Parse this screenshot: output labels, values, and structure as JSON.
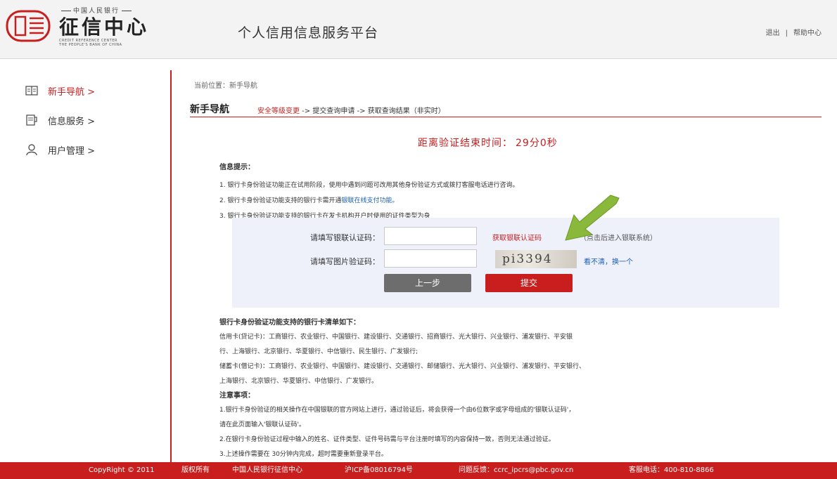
{
  "header": {
    "logo_top": "中国人民银行",
    "logo_main": "征信中心",
    "logo_en_1": "CREDIT REFERENCE CENTER",
    "logo_en_2": "THE PEOPLE'S BANK OF CHINA",
    "platform_title": "个人信用信息服务平台",
    "logout": "退出",
    "separator": "|",
    "help": "帮助中心"
  },
  "sidebar": {
    "items": [
      {
        "label": "新手导航 >",
        "icon": "book-icon",
        "active": true
      },
      {
        "label": "信息服务 >",
        "icon": "document-icon",
        "active": false
      },
      {
        "label": "用户管理 >",
        "icon": "user-icon",
        "active": false
      }
    ]
  },
  "main": {
    "breadcrumb": "当前位置：新手导航",
    "nav_title": "新手导航",
    "step_current": "安全等级变更",
    "step_rest": " -> 提交查询申请 -> 获取查询结果（非实时）",
    "countdown_label": "距离验证结束时间：",
    "countdown_value": "29分0秒",
    "tips_head": "信息提示：",
    "tip1": "1. 银行卡身份验证功能正在试用阶段，使用中遇到问题可改用其他身份验证方式或拨打客服电话进行咨询。",
    "tip2_pre": "2. 银行卡身份验证功能支持的银行卡需开通",
    "tip2_link": "银联在线支付功能。",
    "tip3": "3. 银行卡身份验证功能支持的银行卡在发卡机构开户时使用的证件类型为身",
    "form": {
      "unionpay_label": "请填写银联认证码：",
      "unionpay_value": "",
      "get_code_link": "获取银联认证码",
      "get_code_hint": "（点击后进入银联系统）",
      "captcha_label": "请填写图片验证码：",
      "captcha_value": "",
      "captcha_text": "pi3394",
      "refresh_link": "看不清，换一个",
      "prev_button": "上一步",
      "submit_button": "提交"
    },
    "support_head": "银行卡身份验证功能支持的银行卡清单如下：",
    "credit_line1": "信用卡(贷记卡)：工商银行、农业银行、中国银行、建设银行、交通银行、招商银行、光大银行、兴业银行、浦发银行、平安银",
    "credit_line2": "行、上海银行、北京银行、华夏银行、中信银行、民生银行、广发银行;",
    "debit_line1": "储蓄卡(借记卡)：工商银行、农业银行、中国银行、建设银行、交通银行、邮储银行、光大银行、兴业银行、浦发银行、平安银行、",
    "debit_line2": "上海银行、北京银行、华夏银行、中信银行、广发银行。",
    "notice_head": "注意事项：",
    "notice1a": "1.银行卡身份验证的相关操作在中国银联的官方网站上进行，通过验证后，将会获得一个由6位数字或字母组成的'银联认证码'，",
    "notice1b": "请在此页面输入'银联认证码'。",
    "notice2": "2.在银行卡身份验证过程中输入的姓名、证件类型、证件号码需与平台注册时填写的内容保持一致，否则无法通过验证。",
    "notice3": "3.上述操作需要在 30分钟内完成，超时需要重新登录平台。"
  },
  "footer": {
    "copyright": "CopyRight © 2011",
    "rights": "版权所有",
    "org": "中国人民银行征信中心",
    "icp": "沪ICP备08016794号",
    "feedback": "问题反馈：ccrc_ipcrs@pbc.gov.cn",
    "phone": "客服电话：400-810-8866"
  },
  "colors": {
    "brand_red": "#c81e1e",
    "link_blue": "#1a5fb4",
    "arrow_green": "#8ab83a"
  }
}
